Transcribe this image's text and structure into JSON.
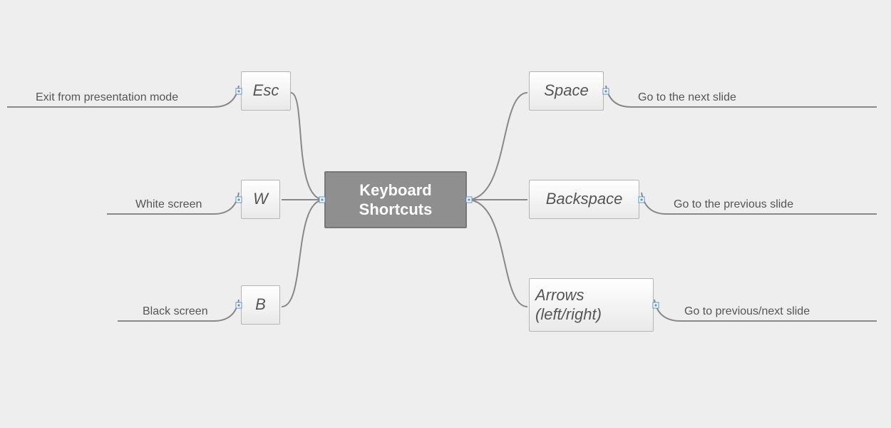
{
  "colors": {
    "background": "#eeeeee",
    "centerFill": "#8f8f8f",
    "centerBorder": "#777777",
    "centerText": "#ffffff",
    "nodeBorder": "#b5b5b5",
    "nodeText": "#555555",
    "connector": "#888888",
    "underline": "#888888",
    "marker": "#5a8fd6"
  },
  "center": {
    "title_line1": "Keyboard",
    "title_line2": "Shortcuts"
  },
  "leftNodes": {
    "esc": {
      "key": "Esc",
      "desc": "Exit from presentation mode"
    },
    "w": {
      "key": "W",
      "desc": "White screen"
    },
    "b": {
      "key": "B",
      "desc": "Black screen"
    }
  },
  "rightNodes": {
    "space": {
      "key": "Space",
      "desc": "Go to the next slide"
    },
    "backspace": {
      "key": "Backspace",
      "desc": "Go to the previous slide"
    },
    "arrows": {
      "key_line1": "Arrows",
      "key_line2": "(left/right)",
      "desc": "Go to previous/next slide"
    }
  }
}
